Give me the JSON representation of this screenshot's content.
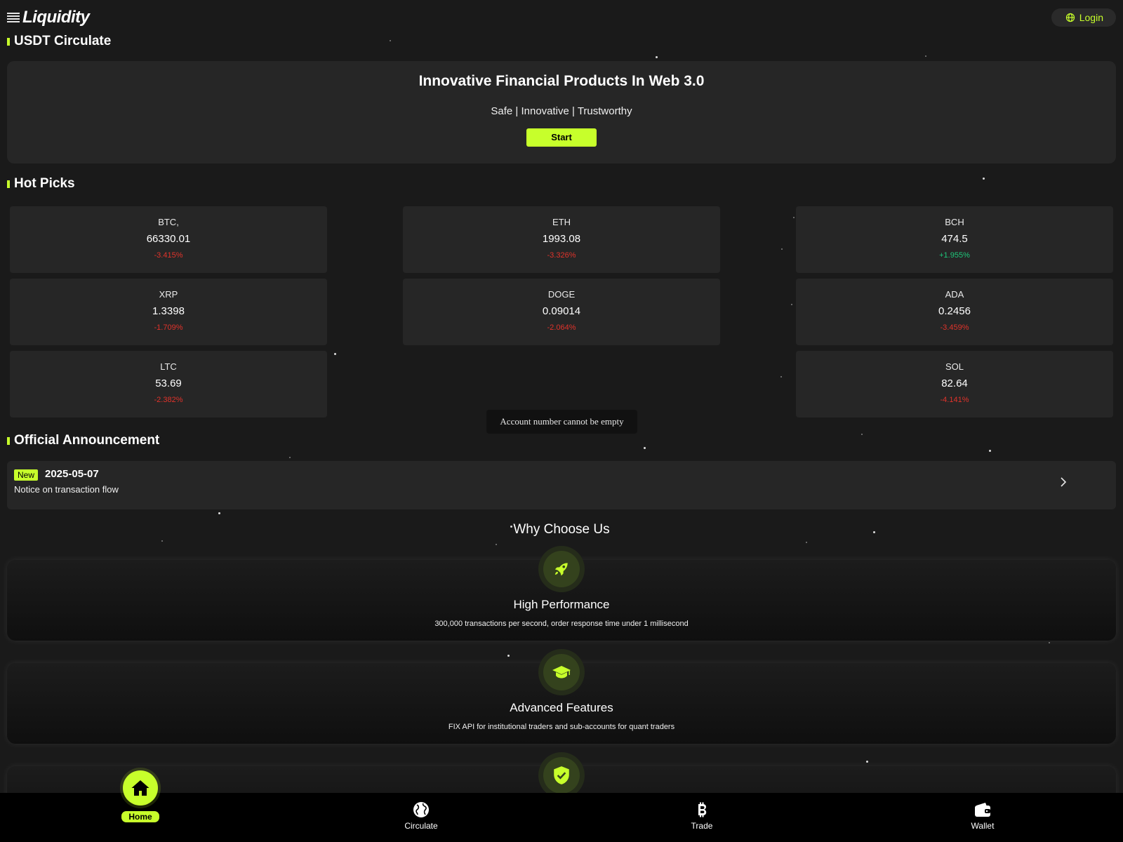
{
  "header": {
    "brand": "Liquidity",
    "login_label": "Login"
  },
  "sections": {
    "usdt": "USDT Circulate",
    "hot_picks": "Hot Picks",
    "announcement": "Official Announcement",
    "why": "Why Choose Us"
  },
  "hero": {
    "title": "Innovative Financial Products In Web 3.0",
    "tagline": "Safe | Innovative | Trustworthy",
    "start_label": "Start"
  },
  "coins": [
    {
      "symbol": "BTC,",
      "price": "66330.01",
      "change": "-3.415%",
      "trend": "down"
    },
    {
      "symbol": "ETH",
      "price": "1993.08",
      "change": "-3.326%",
      "trend": "down"
    },
    {
      "symbol": "BCH",
      "price": "474.5",
      "change": "+1.955%",
      "trend": "up"
    },
    {
      "symbol": "XRP",
      "price": "1.3398",
      "change": "-1.709%",
      "trend": "down"
    },
    {
      "symbol": "DOGE",
      "price": "0.09014",
      "change": "-2.064%",
      "trend": "down"
    },
    {
      "symbol": "ADA",
      "price": "0.2456",
      "change": "-3.459%",
      "trend": "down"
    },
    {
      "symbol": "LTC",
      "price": "53.69",
      "change": "-2.382%",
      "trend": "down"
    },
    {
      "symbol": "SOL",
      "price": "82.64",
      "change": "-4.141%",
      "trend": "down"
    }
  ],
  "toast": "Account number cannot be empty",
  "announcement": {
    "badge": "New",
    "date": "2025-05-07",
    "text": "Notice on transaction flow"
  },
  "features": [
    {
      "icon": "rocket-icon",
      "title": "High Performance",
      "desc": "300,000 transactions per second, order response time under 1 millisecond"
    },
    {
      "icon": "graduation-cap-icon",
      "title": "Advanced Features",
      "desc": "FIX API for institutional traders and sub-accounts for quant traders"
    },
    {
      "icon": "shield-check-icon",
      "title": "",
      "desc": ""
    }
  ],
  "nav": {
    "home": "Home",
    "circulate": "Circulate",
    "trade": "Trade",
    "wallet": "Wallet"
  },
  "colors": {
    "accent": "#c7ff2b",
    "background": "#1a1a1a",
    "card": "#262626",
    "negative": "#e0332b",
    "positive": "#1ec77a"
  }
}
